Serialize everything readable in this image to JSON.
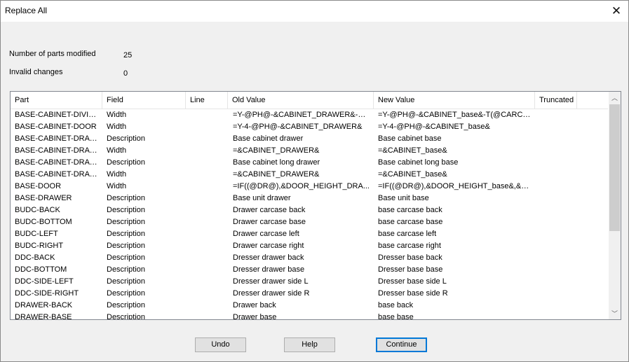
{
  "window": {
    "title": "Replace All"
  },
  "stats": {
    "parts_modified_label": "Number of parts modified",
    "parts_modified_value": "25",
    "invalid_changes_label": "Invalid changes",
    "invalid_changes_value": "0"
  },
  "table": {
    "columns": [
      "Part",
      "Field",
      "Line",
      "Old Value",
      "New Value",
      "Truncated"
    ],
    "rows": [
      {
        "part": "BASE-CABINET-DIVIDER",
        "field": "Width",
        "line": "",
        "old": "=Y-@PH@-&CABINET_DRAWER&-T(...",
        "new": "=Y-@PH@-&CABINET_base&-T(@CARCAS...",
        "truncated": ""
      },
      {
        "part": "BASE-CABINET-DOOR",
        "field": "Width",
        "line": "",
        "old": "=Y-4-@PH@-&CABINET_DRAWER&",
        "new": "=Y-4-@PH@-&CABINET_base&",
        "truncated": ""
      },
      {
        "part": "BASE-CABINET-DRAWER",
        "field": "Description",
        "line": "",
        "old": "Base cabinet drawer",
        "new": "Base cabinet base",
        "truncated": ""
      },
      {
        "part": "BASE-CABINET-DRAWER",
        "field": "Width",
        "line": "",
        "old": "=&CABINET_DRAWER&",
        "new": "=&CABINET_base&",
        "truncated": ""
      },
      {
        "part": "BASE-CABINET-DRAW...",
        "field": "Description",
        "line": "",
        "old": "Base cabinet long drawer",
        "new": "Base cabinet long base",
        "truncated": ""
      },
      {
        "part": "BASE-CABINET-DRAW...",
        "field": "Width",
        "line": "",
        "old": "=&CABINET_DRAWER&",
        "new": "=&CABINET_base&",
        "truncated": ""
      },
      {
        "part": "BASE-DOOR",
        "field": "Width",
        "line": "",
        "old": "=IF((@DR@),&DOOR_HEIGHT_DRA...",
        "new": "=IF((@DR@),&DOOR_HEIGHT_base&,&D...",
        "truncated": ""
      },
      {
        "part": "BASE-DRAWER",
        "field": "Description",
        "line": "",
        "old": "Base unit drawer",
        "new": "Base unit base",
        "truncated": ""
      },
      {
        "part": "BUDC-BACK",
        "field": "Description",
        "line": "",
        "old": "Drawer carcase back",
        "new": "base carcase back",
        "truncated": ""
      },
      {
        "part": "BUDC-BOTTOM",
        "field": "Description",
        "line": "",
        "old": "Drawer carcase base",
        "new": "base carcase base",
        "truncated": ""
      },
      {
        "part": "BUDC-LEFT",
        "field": "Description",
        "line": "",
        "old": "Drawer carcase left",
        "new": "base carcase left",
        "truncated": ""
      },
      {
        "part": "BUDC-RIGHT",
        "field": "Description",
        "line": "",
        "old": "Drawer carcase right",
        "new": "base carcase right",
        "truncated": ""
      },
      {
        "part": "DDC-BACK",
        "field": "Description",
        "line": "",
        "old": "Dresser drawer back",
        "new": "Dresser base back",
        "truncated": ""
      },
      {
        "part": "DDC-BOTTOM",
        "field": "Description",
        "line": "",
        "old": "Dresser drawer base",
        "new": "Dresser base base",
        "truncated": ""
      },
      {
        "part": "DDC-SIDE-LEFT",
        "field": "Description",
        "line": "",
        "old": "Dresser drawer side L",
        "new": "Dresser base side L",
        "truncated": ""
      },
      {
        "part": "DDC-SIDE-RIGHT",
        "field": "Description",
        "line": "",
        "old": "Dresser drawer side R",
        "new": "Dresser base side R",
        "truncated": ""
      },
      {
        "part": "DRAWER-BACK",
        "field": "Description",
        "line": "",
        "old": "Drawer back",
        "new": "base back",
        "truncated": ""
      },
      {
        "part": "DRAWER-BASE",
        "field": "Description",
        "line": "",
        "old": "Drawer base",
        "new": "base base",
        "truncated": ""
      }
    ]
  },
  "buttons": {
    "undo": "Undo",
    "help": "Help",
    "continue": "Continue"
  },
  "icons": {
    "close": "close-icon",
    "scroll_up": "scroll-up-icon",
    "scroll_down": "scroll-down-icon"
  },
  "colors": {
    "focus_border": "#0078d7",
    "window_bg": "#f0f0f0"
  }
}
